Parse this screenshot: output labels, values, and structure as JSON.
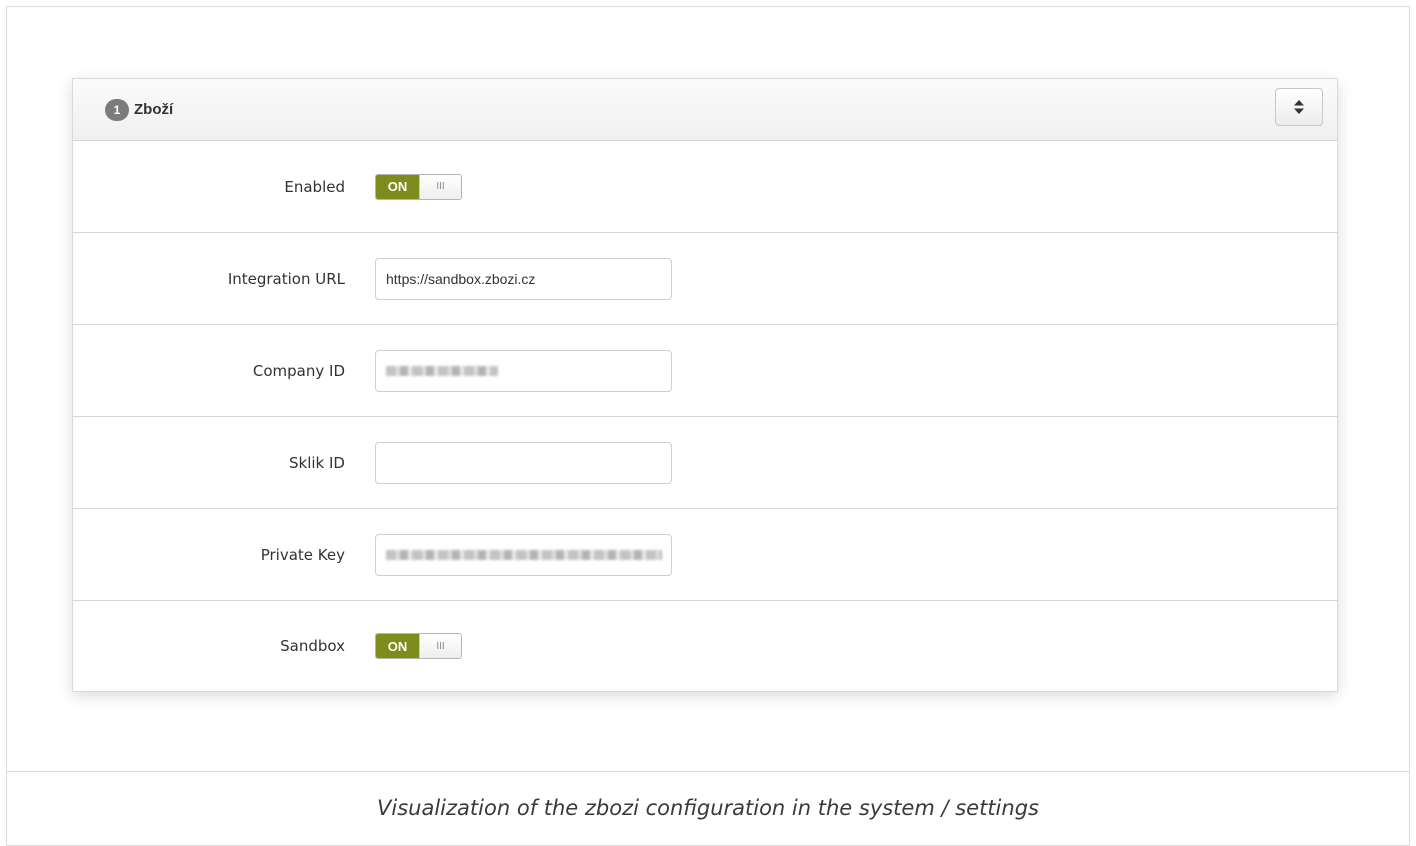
{
  "panel": {
    "badge": "1",
    "title": "Zboží",
    "sort_icon": "sort-updown-icon"
  },
  "fields": {
    "enabled": {
      "label": "Enabled",
      "toggle_on_label": "ON",
      "toggle_handle": "III",
      "state": "on"
    },
    "integration_url": {
      "label": "Integration URL",
      "value": "https://sandbox.zbozi.cz"
    },
    "company_id": {
      "label": "Company ID",
      "value": ""
    },
    "sklik_id": {
      "label": "Sklik ID",
      "value": ""
    },
    "private_key": {
      "label": "Private Key",
      "value": ""
    },
    "sandbox": {
      "label": "Sandbox",
      "toggle_on_label": "ON",
      "toggle_handle": "III",
      "state": "on"
    }
  },
  "caption": "Visualization of the zbozi configuration in the system / settings",
  "colors": {
    "toggle_on": "#7d8c1a",
    "badge": "#7b7b7b"
  }
}
